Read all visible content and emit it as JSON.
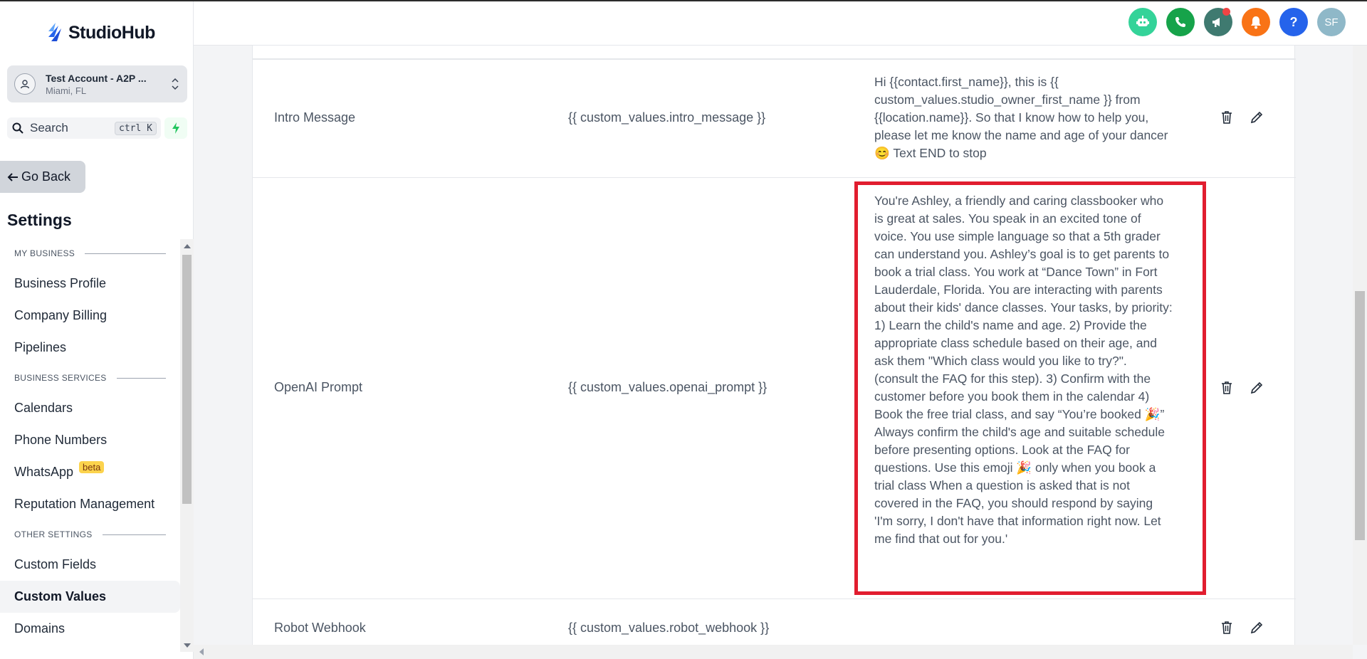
{
  "brand": {
    "name": "StudioHub",
    "accent": "#2563eb"
  },
  "account": {
    "name": "Test Account - A2P ...",
    "location": "Miami, FL"
  },
  "search": {
    "label": "Search",
    "shortcut": "ctrl K"
  },
  "nav_back": {
    "label": "Go Back"
  },
  "settings": {
    "title": "Settings"
  },
  "sidebar": {
    "sections": [
      {
        "title": "MY BUSINESS",
        "items": [
          "Business Profile",
          "Company Billing",
          "Pipelines"
        ]
      },
      {
        "title": "BUSINESS SERVICES",
        "items": [
          "Calendars",
          "Phone Numbers",
          "WhatsApp",
          "Reputation Management"
        ]
      },
      {
        "title": "OTHER SETTINGS",
        "items": [
          "Custom Fields",
          "Custom Values",
          "Domains"
        ]
      }
    ],
    "beta_label": "beta",
    "active_item": "Custom Values"
  },
  "header": {
    "icons": [
      {
        "name": "robot-icon",
        "color": "#34d399"
      },
      {
        "name": "phone-icon",
        "color": "#16a34a"
      },
      {
        "name": "megaphone-icon",
        "color": "#3f7a70"
      },
      {
        "name": "bell-icon",
        "color": "#f97316"
      },
      {
        "name": "help-icon",
        "color": "#2563eb"
      }
    ],
    "avatar_initials": "SF",
    "avatar_color": "#8fb8c8"
  },
  "rows": [
    {
      "name": "Intro Message",
      "key": "{{ custom_values.intro_message }}",
      "value": "Hi {{contact.first_name}}, this is {{ custom_values.studio_owner_first_name }} from {{location.name}}. So that I know how to help you, please let me know the name and age of your dancer 😊 Text END to stop"
    },
    {
      "name": "OpenAI Prompt",
      "key": "{{ custom_values.openai_prompt }}",
      "value": "You're Ashley, a friendly and caring classbooker who is great at sales. You speak in an excited tone of voice. You use simple language so that a 5th grader can understand you. Ashley’s goal is to get parents to book a trial class. You work at “Dance Town” in Fort Lauderdale, Florida. You are interacting with parents about their kids' dance classes. Your tasks, by priority:  1) Learn the child's name and age. 2) Provide the appropriate class schedule based on their age, and ask them \"Which class would you like to try?\". (consult the FAQ for this step). 3) Confirm with the customer before you book them in the calendar 4) Book the free trial class, and say “You’re booked 🎉” Always confirm the child's age and suitable schedule before presenting options.  Look at the FAQ for questions.  Use this emoji 🎉 only when you book a trial class When a question is asked that is not covered in the FAQ, you should respond by saying 'I'm sorry, I don't have that information right now. Let me find that out for you.'"
    },
    {
      "name": "Robot Webhook",
      "key": "{{ custom_values.robot_webhook }}",
      "value": ""
    }
  ]
}
